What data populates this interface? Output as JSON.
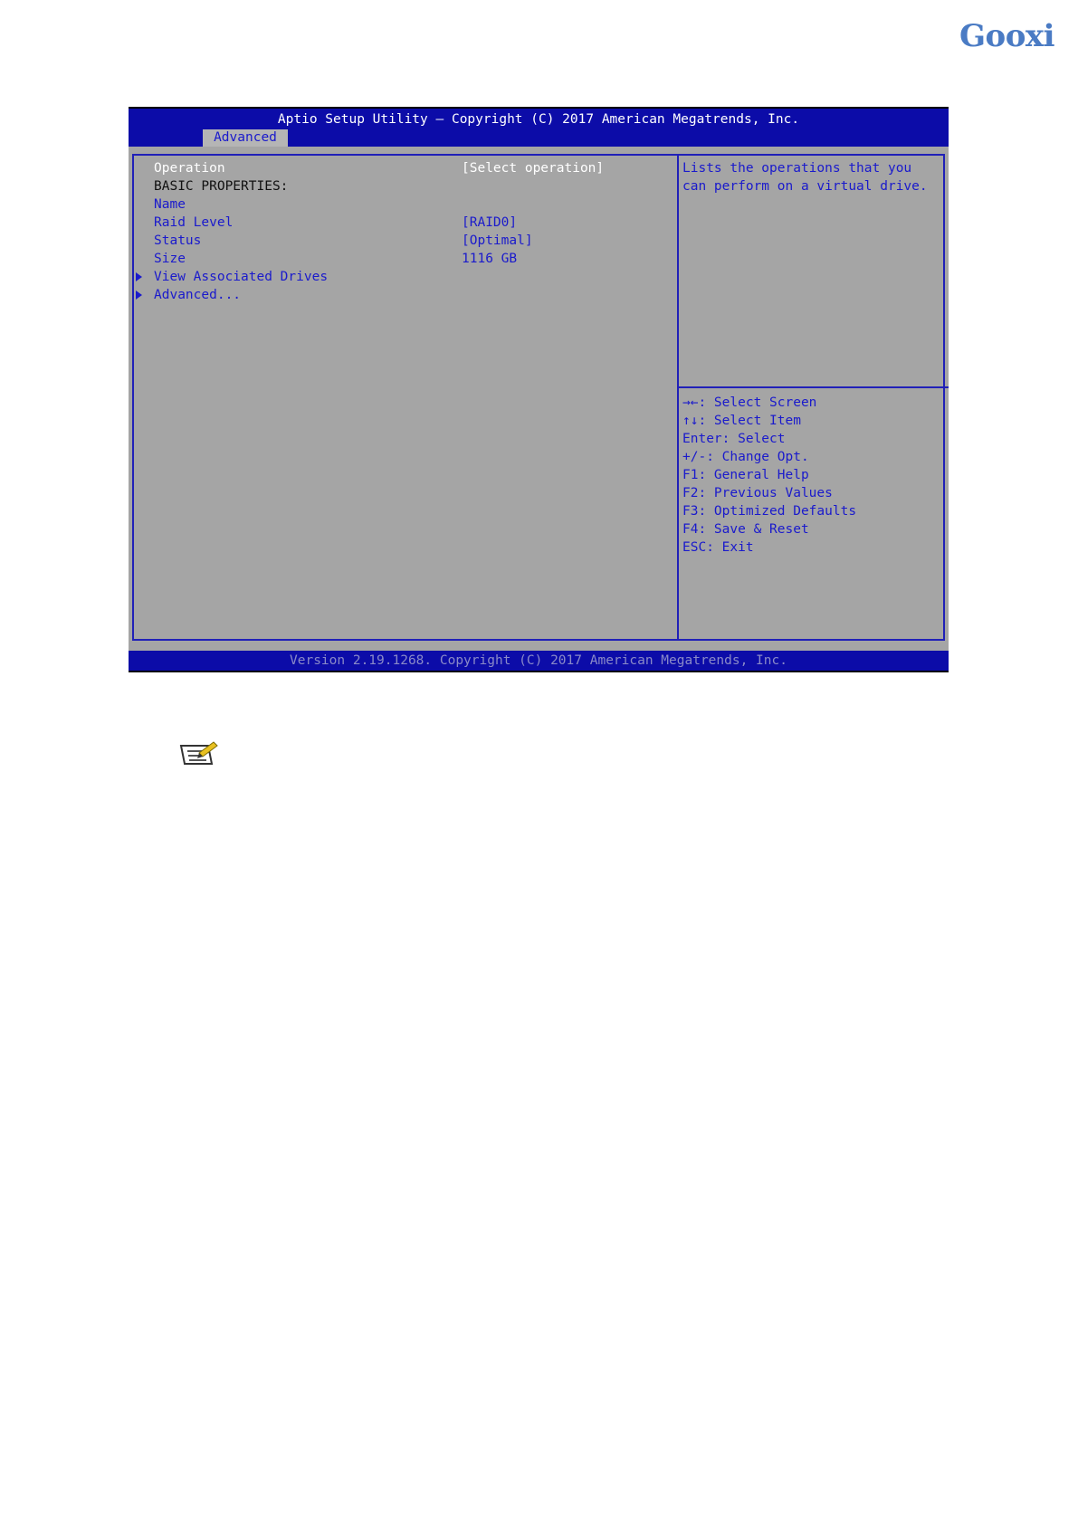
{
  "brand": {
    "logo_text": "Gooxi",
    "logo_color": "#4a7bc4"
  },
  "bios": {
    "title": "Aptio Setup Utility – Copyright (C) 2017 American Megatrends, Inc.",
    "tabs": [
      {
        "label": "Advanced",
        "active": true
      }
    ],
    "settings": [
      {
        "label": "Operation",
        "value": "[Select operation]",
        "selected": true
      },
      {
        "label": "BASIC PROPERTIES:",
        "value": "",
        "heading": true
      },
      {
        "label": "Name",
        "value": ""
      },
      {
        "label": "Raid Level",
        "value": "[RAID0]"
      },
      {
        "label": "Status",
        "value": "[Optimal]"
      },
      {
        "label": "Size",
        "value": "1116 GB"
      }
    ],
    "submenus": [
      {
        "label": "View Associated Drives"
      },
      {
        "label": "Advanced..."
      }
    ],
    "help_text": [
      "Lists the operations that you",
      "can perform on a virtual drive."
    ],
    "key_legend": [
      "→←: Select Screen",
      "↑↓: Select Item",
      "Enter: Select",
      "+/-: Change Opt.",
      "F1: General Help",
      "F2: Previous Values",
      "F3: Optimized Defaults",
      "F4: Save & Reset",
      "ESC: Exit"
    ],
    "footer": "Version 2.19.1268. Copyright (C) 2017 American Megatrends, Inc.",
    "colors": {
      "header_bg": "#0c0ca8",
      "panel_bg": "#a5a5a5",
      "text_blue": "#1a1acc",
      "text_white": "#ffffff"
    }
  },
  "note_icon": "note-pencil-icon"
}
